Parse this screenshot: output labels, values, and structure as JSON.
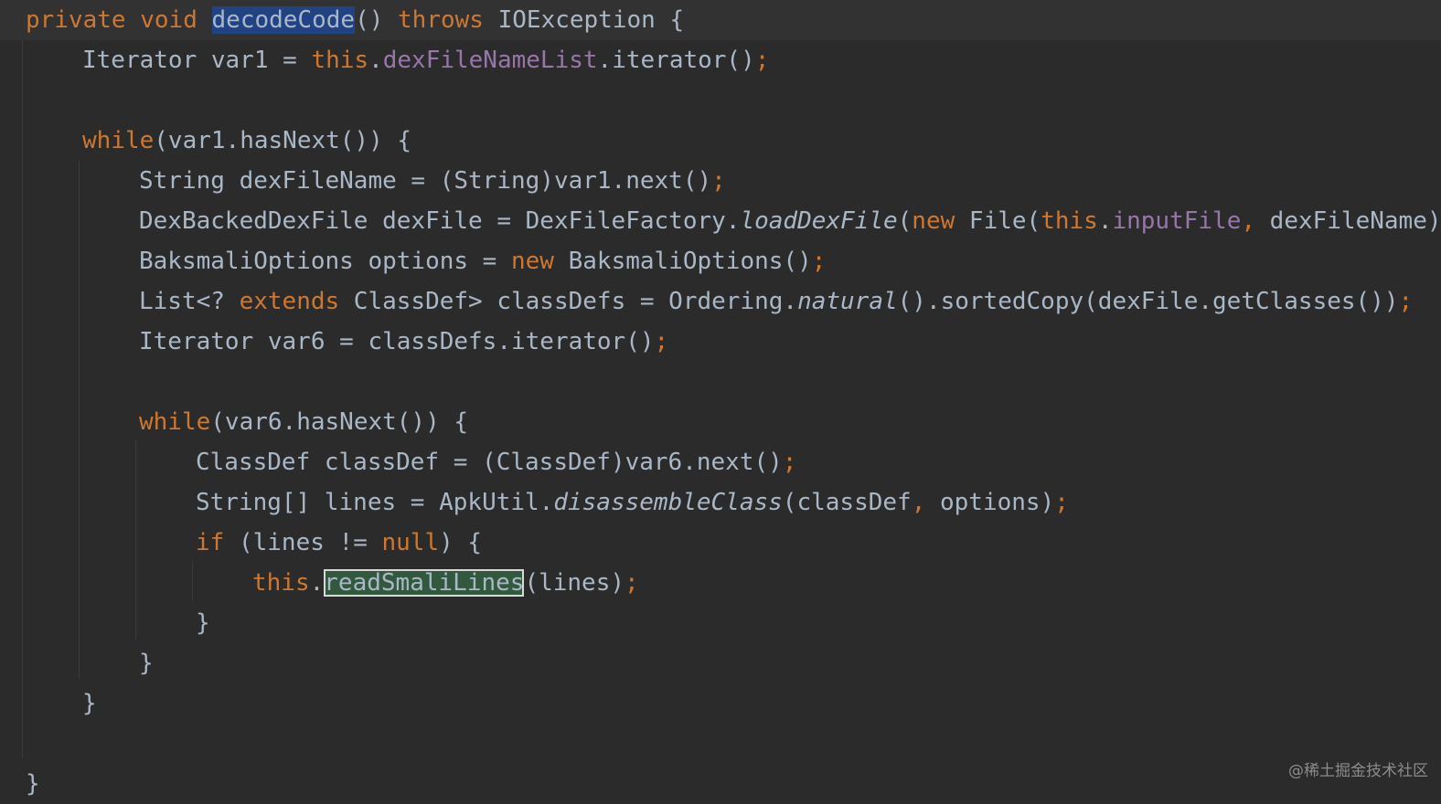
{
  "colors": {
    "background": "#2b2b2b",
    "keyword": "#cc7832",
    "field": "#9876aa",
    "default_text": "#a9b7c6",
    "selection_highlight": "#214283",
    "usage_highlight": "#32593d"
  },
  "code": {
    "l1": {
      "private": "private",
      "void": "void",
      "method": "decodeCode",
      "parens": "()",
      "throws": "throws",
      "exception": "IOException {"
    },
    "l2": {
      "a": "Iterator var1 = ",
      "this": "this",
      "dot": ".",
      "field": "dexFileNameList",
      "b": ".iterator()",
      "semi": ";"
    },
    "l3": {
      "while": "while",
      "rest": "(var1.hasNext()) {"
    },
    "l4": {
      "a": "String dexFileName = (String)var1.next()",
      "semi": ";"
    },
    "l5": {
      "a": "DexBackedDexFile dexFile = DexFileFactory.",
      "call": "loadDexFile",
      "b": "(",
      "new": "new",
      "c": " File(",
      "this": "this",
      "dot": ".",
      "field": "inputFile",
      "comma": ",",
      "d": " dexFileName)"
    },
    "l6": {
      "a": "BaksmaliOptions options = ",
      "new": "new",
      "b": " BaksmaliOptions()",
      "semi": ";"
    },
    "l7": {
      "a": "List<? ",
      "extends": "extends",
      "b": " ClassDef> classDefs = Ordering.",
      "call": "natural",
      "c": "().sortedCopy(dexFile.getClasses())",
      "semi": ";"
    },
    "l8": {
      "a": "Iterator var6 = classDefs.iterator()",
      "semi": ";"
    },
    "l9": {
      "while": "while",
      "rest": "(var6.hasNext()) {"
    },
    "l10": {
      "a": "ClassDef classDef = (ClassDef)var6.next()",
      "semi": ";"
    },
    "l11": {
      "a": "String[] lines = ApkUtil.",
      "call": "disassembleClass",
      "b": "(classDef",
      "comma": ",",
      "c": " options)",
      "semi": ";"
    },
    "l12": {
      "if": "if",
      "a": " (lines != ",
      "null": "null",
      "b": ") {"
    },
    "l13": {
      "this": "this",
      "dot": ".",
      "method": "readSmaliLines",
      "b": "(lines)",
      "semi": ";"
    },
    "l14": "}",
    "l15": "}",
    "l16": "}",
    "l17": "}"
  },
  "watermark": "@稀土掘金技术社区"
}
